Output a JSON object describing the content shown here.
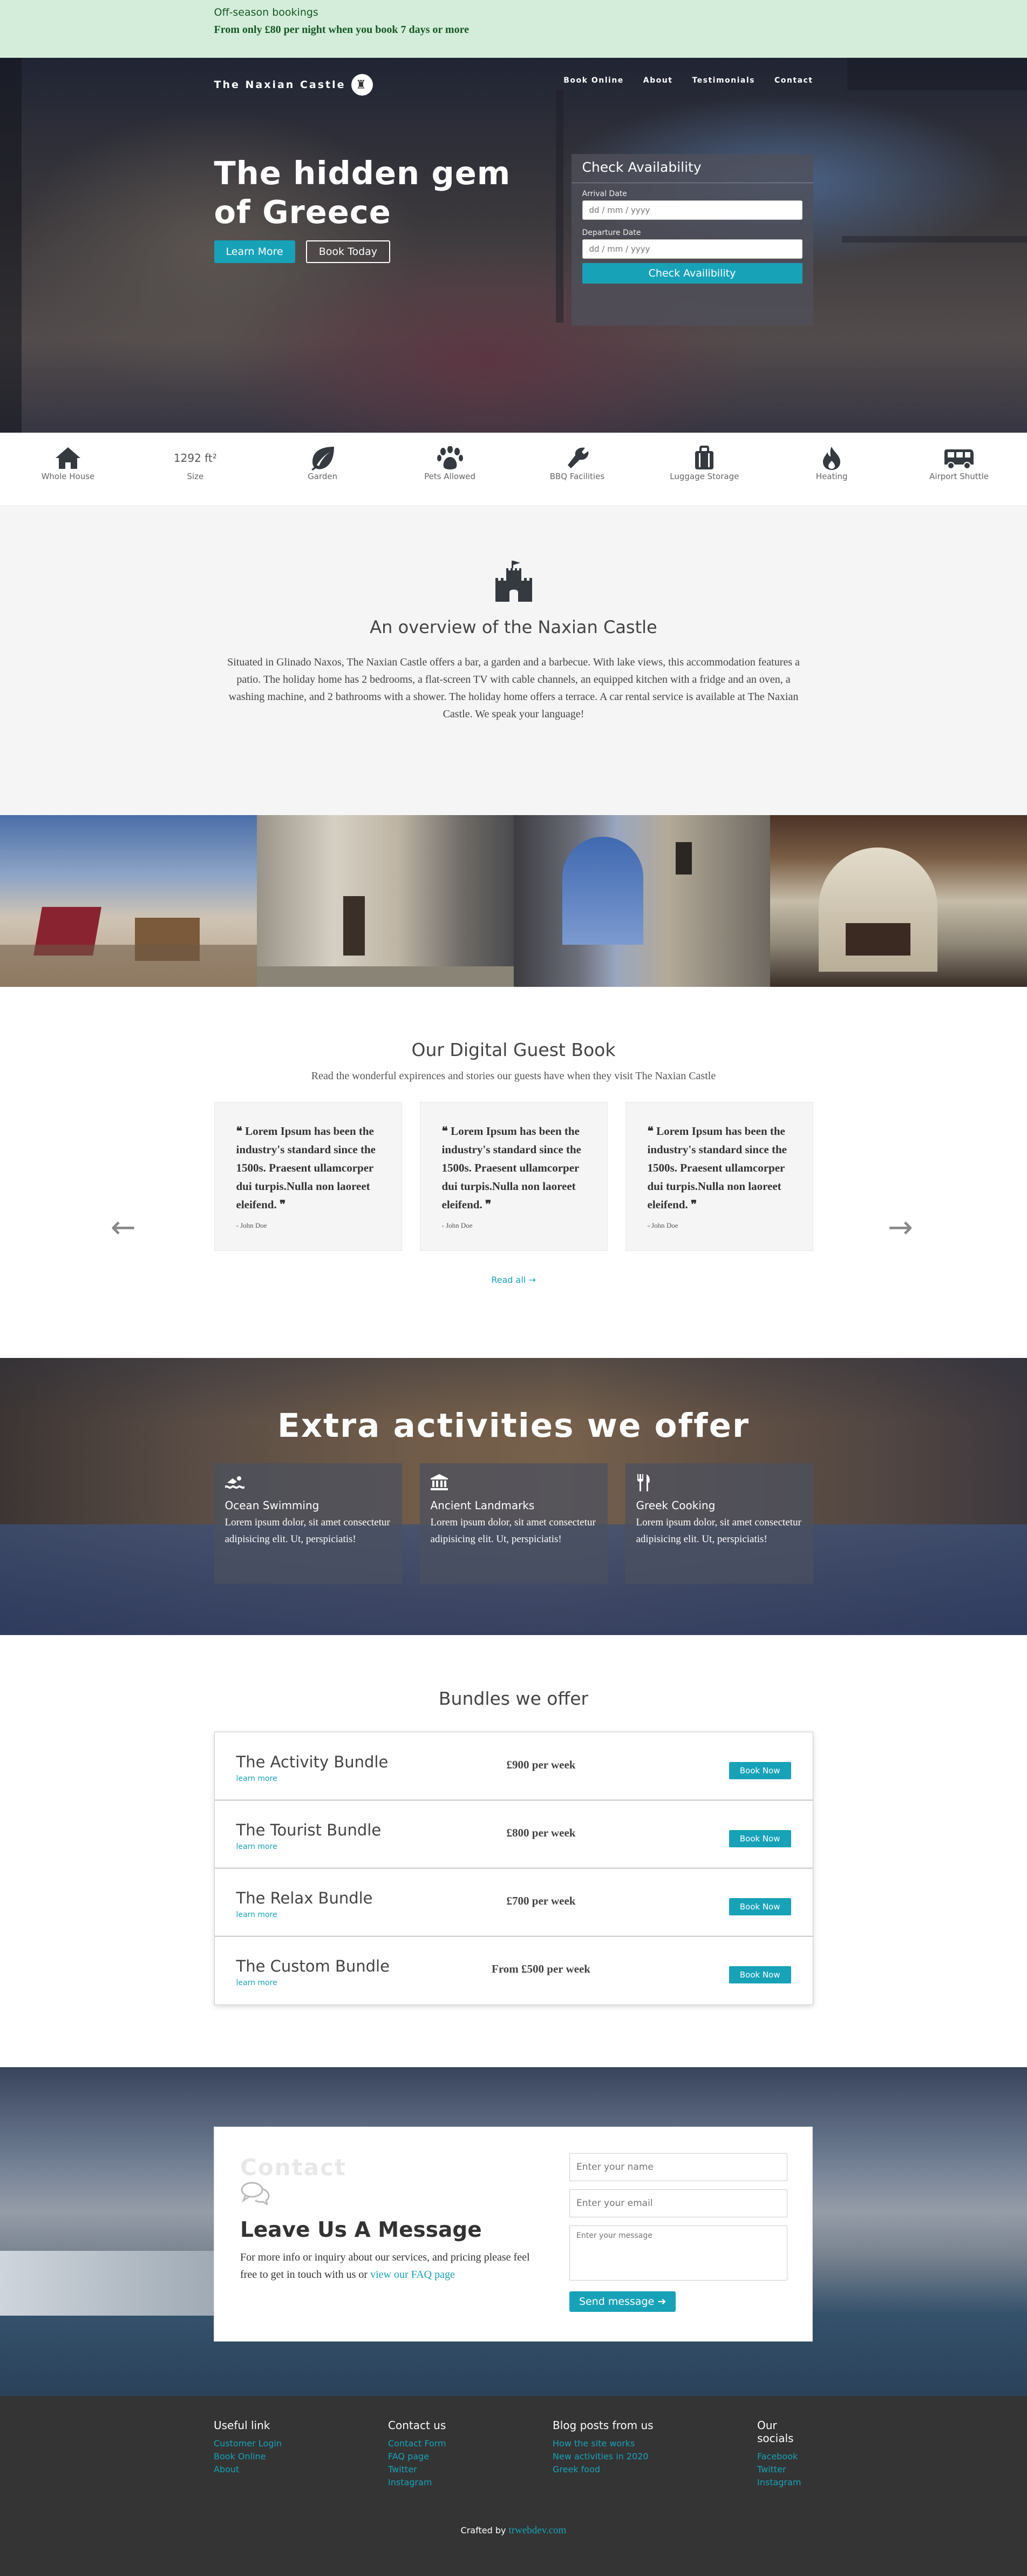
{
  "topbar": {
    "line1": "Off-season bookings",
    "line2": "From only £80 per night when you book 7 days or more"
  },
  "nav": {
    "brand": "The Naxian Castle",
    "links": [
      "Book Online",
      "About",
      "Testimonials",
      "Contact"
    ]
  },
  "hero": {
    "title": "The hidden gem of Greece",
    "learn_more": "Learn More",
    "book_today": "Book Today",
    "availability": {
      "title": "Check Availability",
      "arrival_label": "Arrival Date",
      "departure_label": "Departure Date",
      "date_placeholder": "dd / mm / yyyy",
      "button": "Check Availibility"
    }
  },
  "amenities": [
    {
      "icon": "house-icon",
      "label": "Whole House"
    },
    {
      "icon": "size",
      "label": "Size",
      "value": "1292 ft²"
    },
    {
      "icon": "leaf-icon",
      "label": "Garden"
    },
    {
      "icon": "paw-icon",
      "label": "Pets Allowed"
    },
    {
      "icon": "bbq-icon",
      "label": "BBQ Facilities"
    },
    {
      "icon": "luggage-icon",
      "label": "Luggage Storage"
    },
    {
      "icon": "fire-icon",
      "label": "Heating"
    },
    {
      "icon": "shuttle-icon",
      "label": "Airport Shuttle"
    }
  ],
  "overview": {
    "icon": "castle-icon",
    "title": "An overview of the Naxian Castle",
    "text": "Situated in Glinado Naxos, The Naxian Castle offers a bar, a garden and a barbecue. With lake views, this accommodation features a patio. The holiday home has 2 bedrooms, a flat-screen TV with cable channels, an equipped kitchen with a fridge and an oven, a washing machine, and 2 bathrooms with a shower. The holiday home offers a terrace. A car rental service is available at The Naxian Castle. We speak your language!"
  },
  "guestbook": {
    "title": "Our Digital Guest Book",
    "subtitle": "Read the wonderful expirences and stories our guests have when they visit The Naxian Castle",
    "cards": [
      {
        "quote": "Lorem Ipsum has been the industry's standard since the 1500s. Praesent ullamcorper dui turpis.Nulla non laoreet eleifend.",
        "author": "- John Doe"
      },
      {
        "quote": "Lorem Ipsum has been the industry's standard since the 1500s. Praesent ullamcorper dui turpis.Nulla non laoreet eleifend.",
        "author": "- John Doe"
      },
      {
        "quote": "Lorem Ipsum has been the industry's standard since the 1500s. Praesent ullamcorper dui turpis.Nulla non laoreet eleifend.",
        "author": "- John Doe"
      }
    ],
    "prev": "←",
    "next": "→",
    "read_all": "Read all →"
  },
  "activities": {
    "title": "Extra activities we offer",
    "cards": [
      {
        "icon": "swimmer-icon",
        "title": "Ocean Swimming",
        "text": "Lorem ipsum dolor, sit amet consectetur adipisicing elit. Ut, perspiciatis!"
      },
      {
        "icon": "landmark-icon",
        "title": "Ancient Landmarks",
        "text": "Lorem ipsum dolor, sit amet consectetur adipisicing elit. Ut, perspiciatis!"
      },
      {
        "icon": "utensils-icon",
        "title": "Greek Cooking",
        "text": "Lorem ipsum dolor, sit amet consectetur adipisicing elit. Ut, perspiciatis!"
      }
    ]
  },
  "bundles": {
    "title": "Bundles we offer",
    "items": [
      {
        "name": "The Activity Bundle",
        "link": "learn more",
        "price": "£900 per week",
        "button": "Book Now"
      },
      {
        "name": "The Tourist Bundle",
        "link": "learn more",
        "price": "£800 per week",
        "button": "Book Now"
      },
      {
        "name": "The Relax Bundle",
        "link": "learn more",
        "price": "£700 per week",
        "button": "Book Now"
      },
      {
        "name": "The Custom Bundle",
        "link": "learn more",
        "price": "From £500 per week",
        "button": "Book Now"
      }
    ]
  },
  "contact": {
    "ghost": "Contact",
    "title": "Leave Us A Message",
    "text": "For more info or inquiry about our services, and pricing please feel free to get in touch with us or",
    "faq_link": "view our FAQ page",
    "name_placeholder": "Enter your name",
    "email_placeholder": "Enter your email",
    "message_placeholder": "Enter your message",
    "send": "Send message ➔"
  },
  "footer": {
    "cols": [
      {
        "title": "Useful link",
        "links": [
          "Customer Login",
          "Book Online",
          "About"
        ]
      },
      {
        "title": "Contact us",
        "links": [
          "Contact Form",
          "FAQ page",
          "Twitter",
          "Instagram"
        ]
      },
      {
        "title": "Blog posts from us",
        "links": [
          "How the site works",
          "New activities in 2020",
          "Greek food"
        ]
      },
      {
        "title": "Our socials",
        "links": [
          "Facebook",
          "Twitter",
          "Instagram"
        ]
      }
    ],
    "credit_prefix": "Crafted by",
    "credit_link": "trwebdev.com"
  },
  "colors": {
    "accent": "#17a2b8",
    "banner_bg": "#d4edda",
    "banner_text": "#155724",
    "footer_bg": "#343434"
  }
}
